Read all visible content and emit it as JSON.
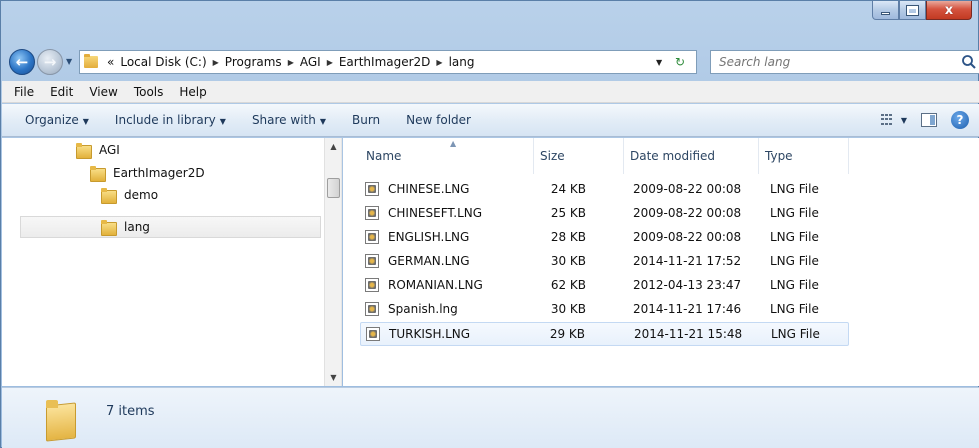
{
  "titlebar": {
    "buttons": {
      "minimize": "",
      "maximize": "",
      "close": "x"
    }
  },
  "address": {
    "overflow": "«",
    "crumbs": [
      "Local Disk (C:)",
      "Programs",
      "AGI",
      "EarthImager2D",
      "lang"
    ]
  },
  "search": {
    "placeholder": "Search lang"
  },
  "menu": {
    "items": [
      {
        "label": "File"
      },
      {
        "label": "Edit"
      },
      {
        "label": "View"
      },
      {
        "label": "Tools"
      },
      {
        "label": "Help"
      }
    ]
  },
  "commands": {
    "organize": "Organize",
    "include": "Include in library",
    "share": "Share with",
    "burn": "Burn",
    "new_folder": "New folder"
  },
  "tree": {
    "items": [
      {
        "label": "AGI",
        "icon": "folder-icon"
      },
      {
        "label": "EarthImager2D",
        "icon": "folder-icon"
      },
      {
        "label": "demo",
        "icon": "folder-icon"
      },
      {
        "label": "lang",
        "icon": "folder-icon",
        "selected": true
      }
    ]
  },
  "files": {
    "columns": [
      "Name",
      "Size",
      "Date modified",
      "Type"
    ],
    "rows": [
      {
        "name": "CHINESE.LNG",
        "size": "24 KB",
        "date": "2009-08-22 00:08",
        "type": "LNG File"
      },
      {
        "name": "CHINESEFT.LNG",
        "size": "25 KB",
        "date": "2009-08-22 00:08",
        "type": "LNG File"
      },
      {
        "name": "ENGLISH.LNG",
        "size": "28 KB",
        "date": "2009-08-22 00:08",
        "type": "LNG File"
      },
      {
        "name": "GERMAN.LNG",
        "size": "30 KB",
        "date": "2014-11-21 17:52",
        "type": "LNG File"
      },
      {
        "name": "ROMANIAN.LNG",
        "size": "62 KB",
        "date": "2012-04-13 23:47",
        "type": "LNG File"
      },
      {
        "name": "Spanish.lng",
        "size": "30 KB",
        "date": "2014-11-21 17:46",
        "type": "LNG File"
      },
      {
        "name": "TURKISH.LNG",
        "size": "29 KB",
        "date": "2014-11-21 15:48",
        "type": "LNG File",
        "selected": true
      }
    ]
  },
  "details": {
    "count": "7 items"
  },
  "colors": {
    "accent": "#1e395b",
    "selection": "#e8f1fc",
    "close": "#c23a22"
  }
}
